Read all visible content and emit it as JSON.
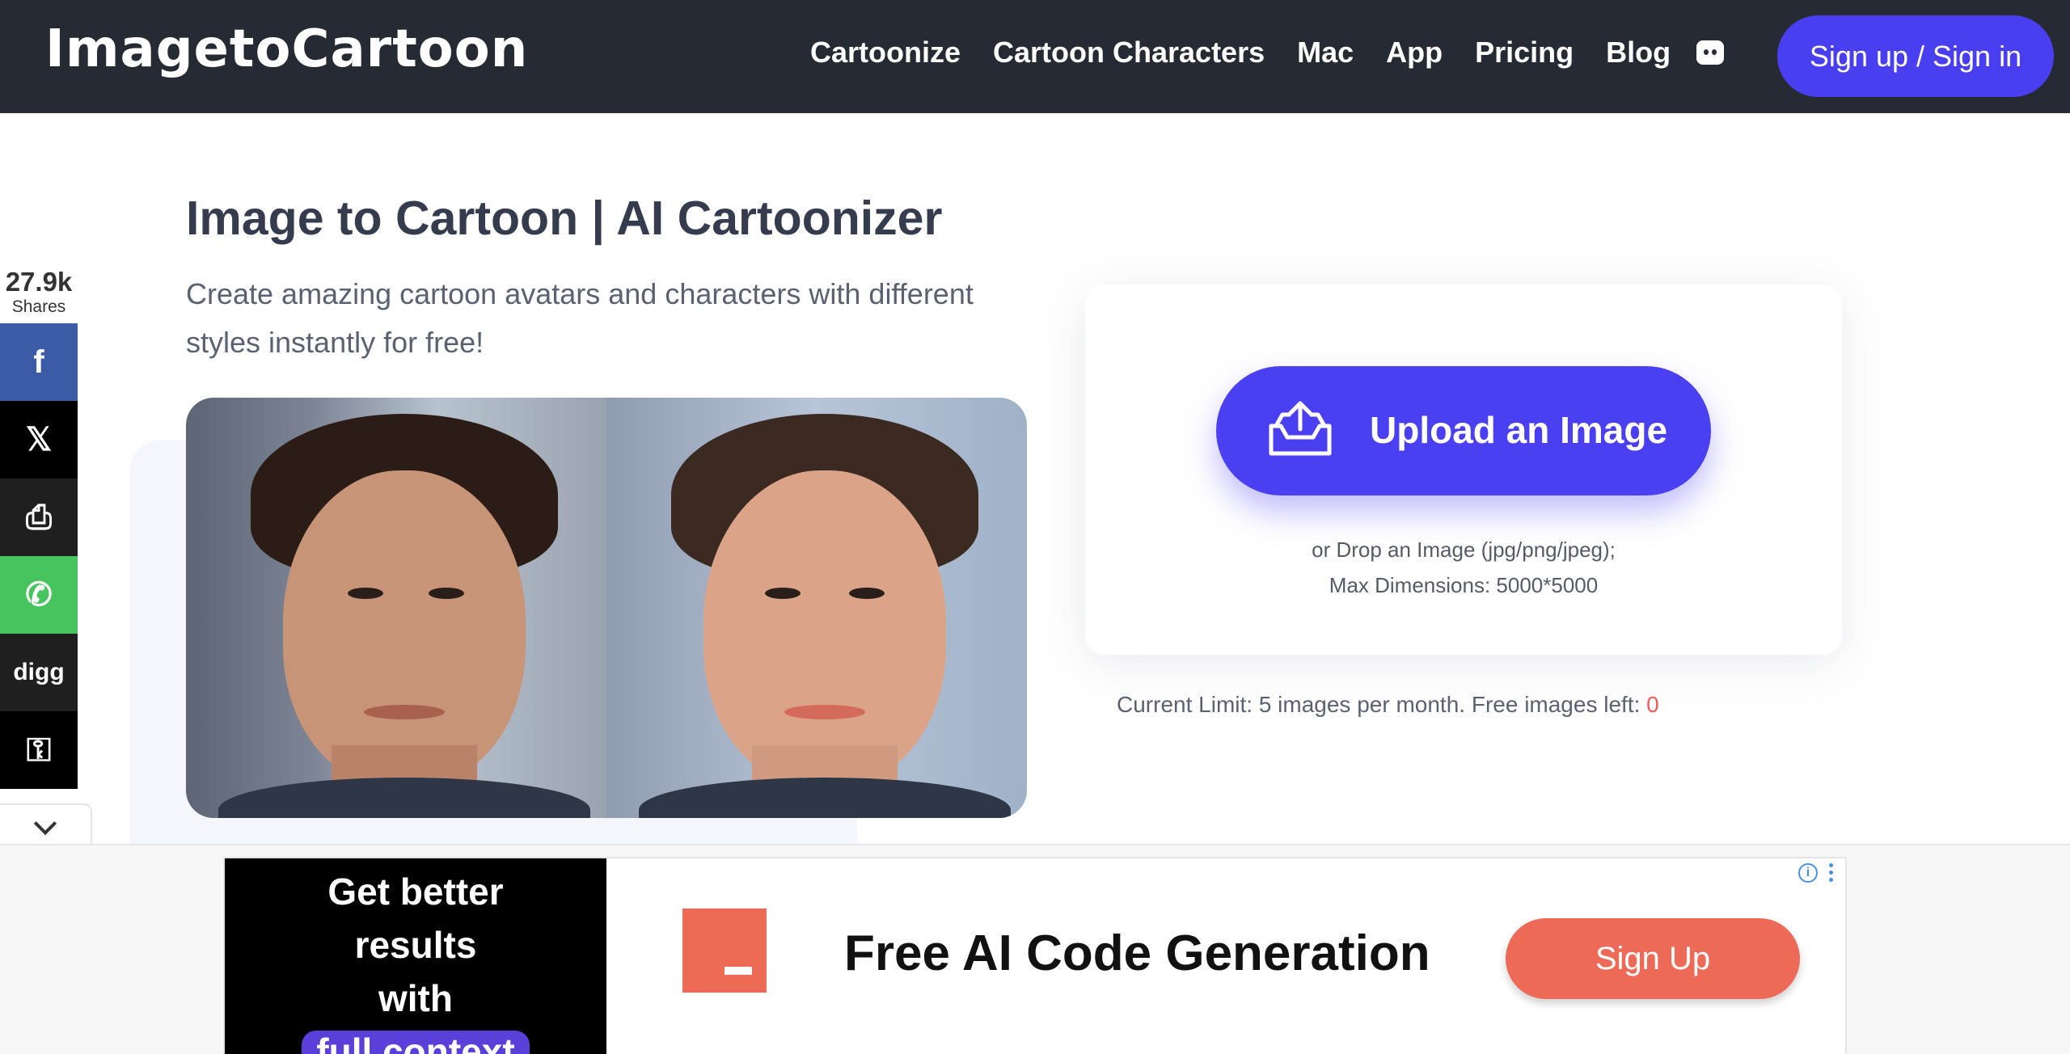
{
  "header": {
    "logo": "ImagetoCartoon",
    "nav": [
      "Cartoonize",
      "Cartoon Characters",
      "Mac",
      "App",
      "Pricing",
      "Blog"
    ],
    "discord_icon": "discord-icon",
    "signin_label": "Sign up / Sign in",
    "bg_color": "#262b33",
    "accent_color": "#4a3ff0"
  },
  "share": {
    "count": "27.9k",
    "count_label": "Shares",
    "buttons": [
      {
        "name": "facebook",
        "icon": "facebook-icon",
        "glyph": "f"
      },
      {
        "name": "x",
        "icon": "x-icon",
        "glyph": "𝕏"
      },
      {
        "name": "print",
        "icon": "printer-icon",
        "glyph": "⎙"
      },
      {
        "name": "whatsapp",
        "icon": "whatsapp-icon",
        "glyph": "✆"
      },
      {
        "name": "digg",
        "icon": "digg-icon",
        "glyph": "digg"
      },
      {
        "name": "more",
        "icon": "more-icon",
        "glyph": "⚿"
      }
    ]
  },
  "hero": {
    "title": "Image to Cartoon | AI Cartoonizer",
    "subtitle": "Create amazing cartoon avatars and characters with different styles instantly for free!"
  },
  "upload": {
    "button_label": "Upload an Image",
    "hint_line1": "or Drop an Image (jpg/png/jpeg);",
    "hint_line2": "Max Dimensions: 5000*5000"
  },
  "limit": {
    "text": "Current Limit: 5 images per month. Free images left: ",
    "remaining": "0"
  },
  "ad": {
    "left_line1": "Get better",
    "left_line2": "results",
    "left_line3": "with",
    "left_line4": "full context",
    "headline": "Free AI Code Generation",
    "cta": "Sign Up",
    "info": "i"
  }
}
